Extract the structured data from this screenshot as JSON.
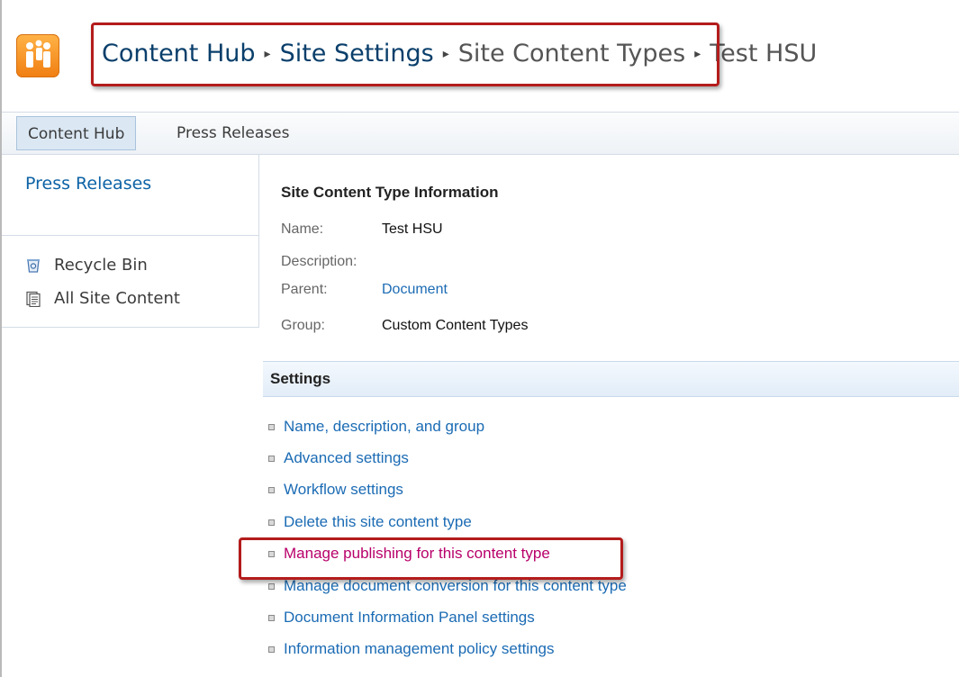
{
  "breadcrumb": {
    "items": [
      "Content Hub",
      "Site Settings",
      "Site Content Types"
    ],
    "current": "Test HSU",
    "separator": "▸"
  },
  "topnav": {
    "tabs": [
      {
        "label": "Content Hub",
        "selected": true
      },
      {
        "label": "Press Releases",
        "selected": false
      }
    ]
  },
  "leftnav": {
    "heading": "Press Releases",
    "links": [
      {
        "label": "Recycle Bin",
        "icon": "recycle-bin-icon"
      },
      {
        "label": "All Site Content",
        "icon": "all-site-content-icon"
      }
    ]
  },
  "info": {
    "title": "Site Content Type Information",
    "fields": [
      {
        "label": "Name:",
        "value": "Test HSU"
      },
      {
        "label": "Description:",
        "value": ""
      },
      {
        "label": "Parent:",
        "value": "Document"
      },
      {
        "label": "Group:",
        "value": "Custom Content Types"
      }
    ]
  },
  "settings": {
    "title": "Settings",
    "items": [
      "Name, description, and group",
      "Advanced settings",
      "Workflow settings",
      "Delete this site content type",
      "Manage publishing for this content type",
      "Manage document conversion for this content type",
      "Document Information Panel settings",
      "Information management policy settings"
    ]
  },
  "colors": {
    "highlight_border": "#b41c1c",
    "link": "#1b6bb4",
    "active_link": "#b8006a",
    "logo": "#f07e12"
  }
}
